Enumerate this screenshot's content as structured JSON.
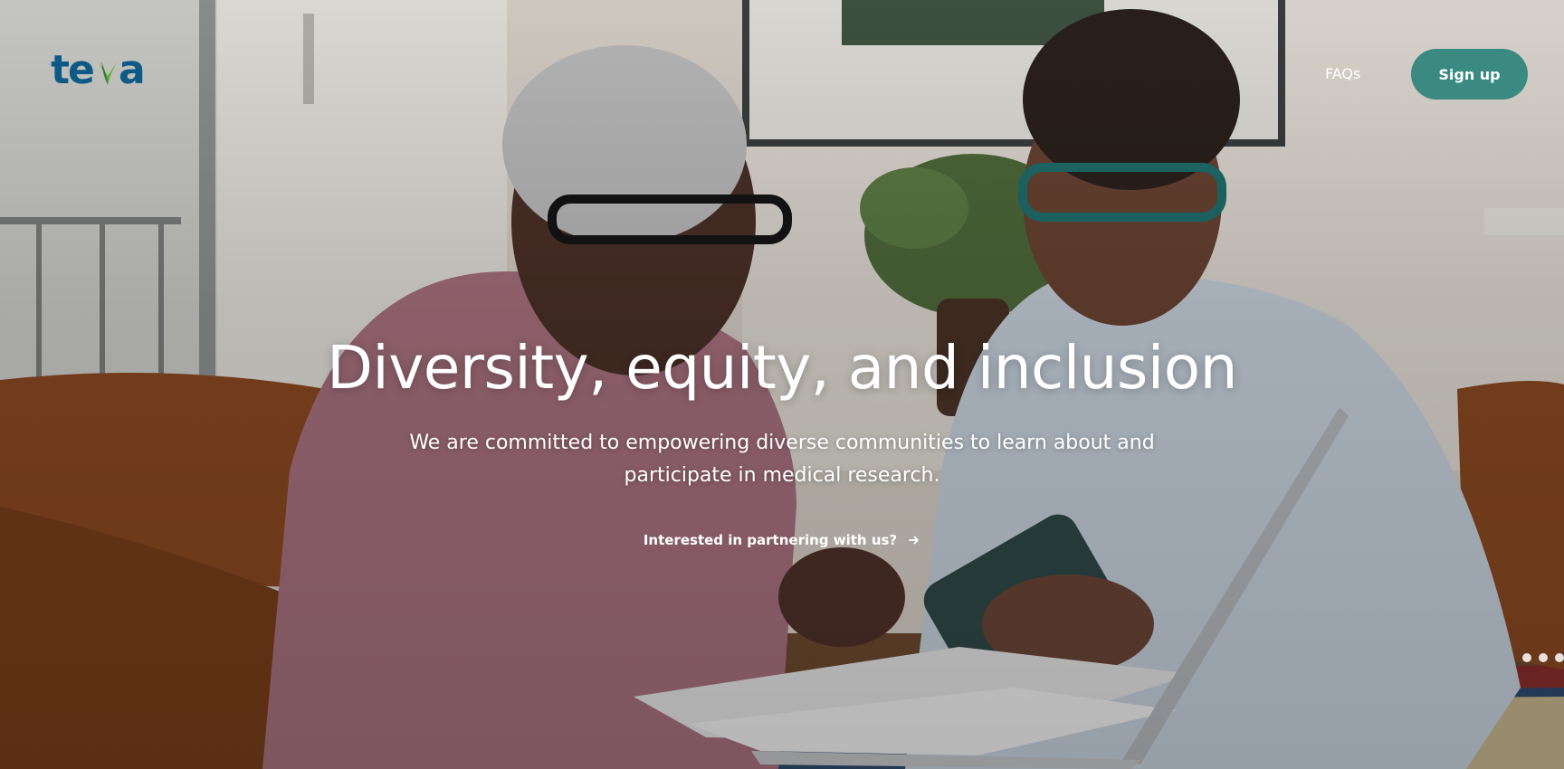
{
  "header": {
    "logo_text": "teva",
    "nav": {
      "faqs_label": "FAQs"
    },
    "signup_label": "Sign up"
  },
  "hero": {
    "title": "Diversity, equity, and inclusion",
    "subtitle": "We are committed to empowering diverse communities to learn about and participate in medical research.",
    "cta_label": "Interested in partnering with us?"
  },
  "colors": {
    "brand_blue": "#0d5a86",
    "brand_green": "#5bb22f",
    "button_teal": "#3a8a82",
    "text_white": "#ffffff"
  },
  "icons": {
    "cta_icon": "arrow-right-icon"
  }
}
